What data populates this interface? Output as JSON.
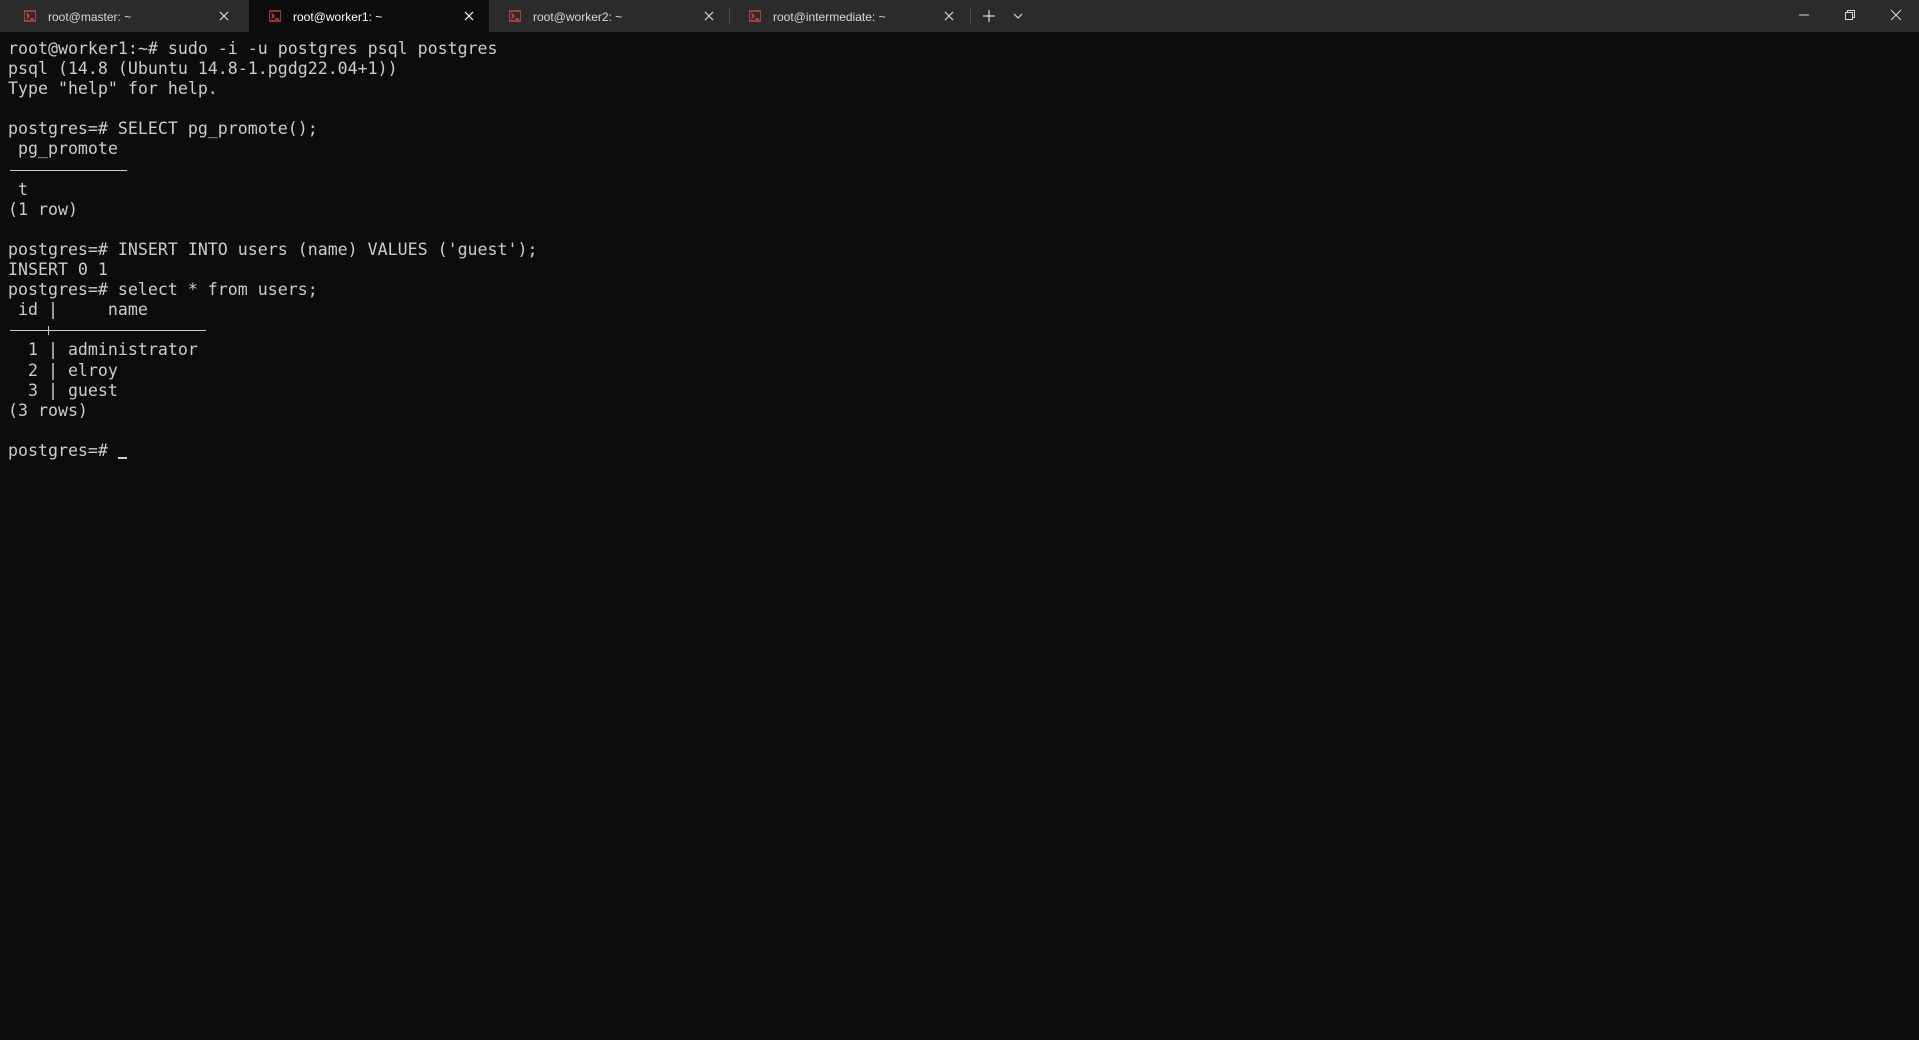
{
  "tabs": [
    {
      "title": "root@master: ~",
      "active": false
    },
    {
      "title": "root@worker1: ~",
      "active": true
    },
    {
      "title": "root@worker2: ~",
      "active": false
    },
    {
      "title": "root@intermediate: ~",
      "active": false
    }
  ],
  "icons": {
    "tab_icon": "terminal-app-icon",
    "tab_close": "close-icon",
    "new_tab": "plus-icon",
    "dropdown": "chevron-down-icon",
    "minimize": "minimize-icon",
    "maximize": "restore-icon",
    "close_window": "close-icon"
  },
  "colors": {
    "accent_icon": "#e04a4a",
    "background": "#0c0c0c",
    "foreground": "#cccccc",
    "titlebar": "#2b2b2b"
  },
  "terminal": {
    "line_01": "root@worker1:~# sudo -i -u postgres psql postgres",
    "line_02": "psql (14.8 (Ubuntu 14.8-1.pgdg22.04+1))",
    "line_03": "Type \"help\" for help.",
    "line_04": "",
    "line_05": "postgres=# SELECT pg_promote();",
    "line_06": " pg_promote",
    "line_08": " t",
    "line_09": "(1 row)",
    "line_10": "",
    "line_11": "postgres=# INSERT INTO users (name) VALUES ('guest');",
    "line_12": "INSERT 0 1",
    "line_13": "postgres=# select * from users;",
    "line_14": " id |     name",
    "rows": [
      "  1 | administrator",
      "  2 | elroy",
      "  3 | guest"
    ],
    "line_18": "(3 rows)",
    "line_19": "",
    "prompt": "postgres=# "
  }
}
